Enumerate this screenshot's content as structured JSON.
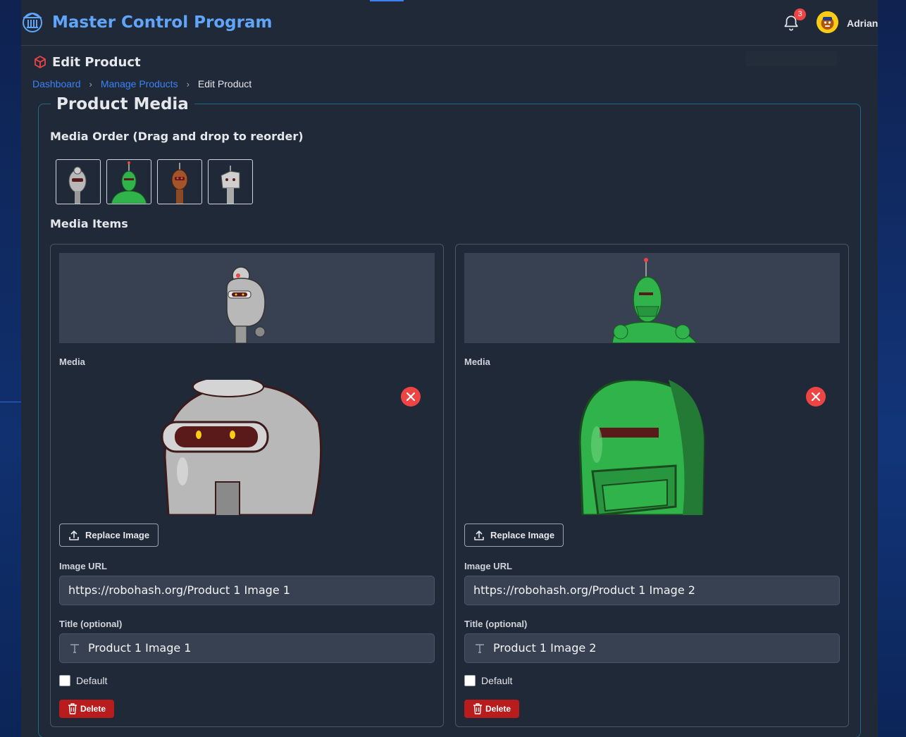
{
  "app": {
    "title": "Master Control Program",
    "notifications_count": "3",
    "user_name": "Adrian",
    "accent_color": "#60a5fa"
  },
  "page": {
    "title": "Edit Product",
    "breadcrumb": [
      "Dashboard",
      "Manage Products",
      "Edit Product"
    ]
  },
  "media_section": {
    "legend": "Product Media",
    "order_label": "Media Order (Drag and drop to reorder)",
    "items_label": "Media Items",
    "thumbnails": [
      {
        "name": "gray-robot-thumb",
        "color": "#b8b8b8"
      },
      {
        "name": "green-robot-thumb",
        "color": "#2fb34a"
      },
      {
        "name": "brown-robot-thumb",
        "color": "#a3542a"
      },
      {
        "name": "white-robot-thumb",
        "color": "#cfcfcf"
      }
    ],
    "items": [
      {
        "media_label": "Media",
        "replace_label": "Replace Image",
        "url_label": "Image URL",
        "url_value": "https://robohash.org/Product 1 Image 1",
        "title_label": "Title (optional)",
        "title_value": "Product 1 Image 1",
        "default_label": "Default",
        "default_checked": false,
        "delete_label": "Delete",
        "robot_color": "#b8b8b8"
      },
      {
        "media_label": "Media",
        "replace_label": "Replace Image",
        "url_label": "Image URL",
        "url_value": "https://robohash.org/Product 1 Image 2",
        "title_label": "Title (optional)",
        "title_value": "Product 1 Image 2",
        "default_label": "Default",
        "default_checked": false,
        "delete_label": "Delete",
        "robot_color": "#2fb34a"
      }
    ]
  }
}
